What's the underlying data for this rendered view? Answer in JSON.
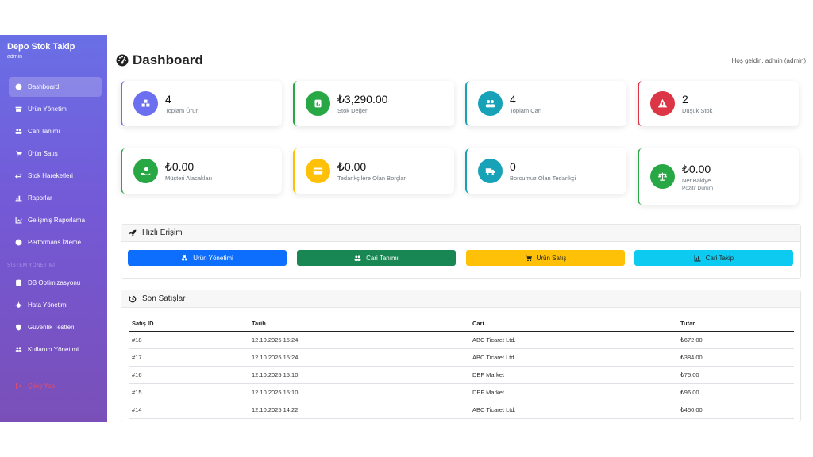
{
  "sidebar": {
    "brand": "Depo Stok Takip",
    "user": "admin",
    "items": [
      {
        "label": "Dashboard",
        "icon": "dashboard-icon"
      },
      {
        "label": "Ürün Yönetimi",
        "icon": "box-icon"
      },
      {
        "label": "Cari Tanımı",
        "icon": "users-icon"
      },
      {
        "label": "Ürün Satış",
        "icon": "cart-icon"
      },
      {
        "label": "Stok Hareketleri",
        "icon": "exchange-icon"
      },
      {
        "label": "Raporlar",
        "icon": "chart-bar-icon"
      },
      {
        "label": "Gelişmiş Raporlama",
        "icon": "chart-line-icon"
      },
      {
        "label": "Performans İzleme",
        "icon": "gauge-icon"
      },
      {
        "label": "DB Optimizasyonu",
        "icon": "database-icon"
      },
      {
        "label": "Hata Yönetimi",
        "icon": "bug-icon"
      },
      {
        "label": "Güvenlik Testleri",
        "icon": "shield-icon"
      },
      {
        "label": "Kullanıcı Yönetimi",
        "icon": "users-cog-icon"
      }
    ],
    "section_label": "SİSTEM YÖNETİMİ",
    "logout": "Çıkış Yap"
  },
  "header": {
    "title": "Dashboard",
    "welcome": "Hoş geldin, admin (admin)"
  },
  "stats": [
    {
      "value": "4",
      "label": "Toplam Ürün",
      "color": "#6c6ff0",
      "icon": "boxes-icon"
    },
    {
      "value": "₺3,290.00",
      "label": "Stok Değeri",
      "color": "#28a745",
      "icon": "lira-icon"
    },
    {
      "value": "4",
      "label": "Toplam Cari",
      "color": "#17a2b8",
      "icon": "users-icon"
    },
    {
      "value": "2",
      "label": "Düşük Stok",
      "color": "#dc3545",
      "icon": "warning-icon"
    },
    {
      "value": "₺0.00",
      "label": "Müşteri Alacakları",
      "color": "#28a745",
      "icon": "hand-money-icon"
    },
    {
      "value": "₺0.00",
      "label": "Tedarikçilere Olan Borçlar",
      "color": "#ffc107",
      "icon": "credit-card-icon"
    },
    {
      "value": "0",
      "label": "Borcumuz Olan Tedarikçi",
      "color": "#17a2b8",
      "icon": "truck-icon"
    },
    {
      "value": "₺0.00",
      "label": "Net Bakiye",
      "sub": "Pozitif Durum",
      "color": "#28a745",
      "icon": "balance-scale-icon"
    }
  ],
  "quick_access": {
    "title": "Hızlı Erişim",
    "buttons": [
      {
        "label": "Ürün Yönetimi",
        "color": "#0d6efd"
      },
      {
        "label": "Cari Tanımı",
        "color": "#198754"
      },
      {
        "label": "Ürün Satış",
        "color": "#ffc107"
      },
      {
        "label": "Cari Takip",
        "color": "#0dcaf0"
      }
    ]
  },
  "recent_sales": {
    "title": "Son Satışlar",
    "columns": [
      "Satış ID",
      "Tarih",
      "Cari",
      "Tutar"
    ],
    "rows": [
      [
        "#18",
        "12.10.2025 15:24",
        "ABC Ticaret Ltd.",
        "₺672.00"
      ],
      [
        "#17",
        "12.10.2025 15:24",
        "ABC Ticaret Ltd.",
        "₺384.00"
      ],
      [
        "#16",
        "12.10.2025 15:10",
        "DEF Market",
        "₺75.00"
      ],
      [
        "#15",
        "12.10.2025 15:10",
        "DEF Market",
        "₺96.00"
      ],
      [
        "#14",
        "12.10.2025 14:22",
        "ABC Ticaret Ltd.",
        "₺450.00"
      ]
    ]
  }
}
